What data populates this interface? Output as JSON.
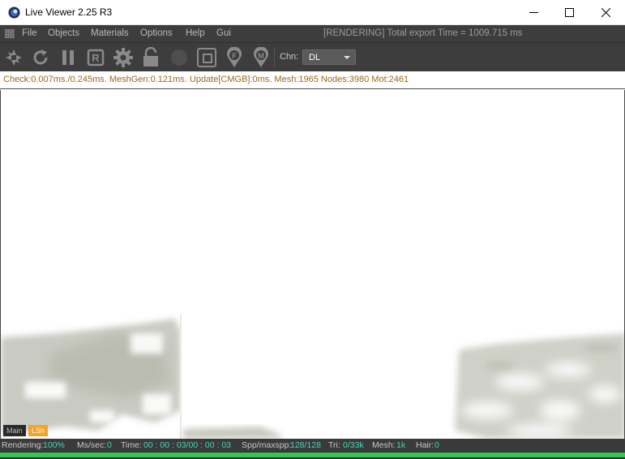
{
  "window": {
    "title": "Live Viewer 2.25 R3"
  },
  "menu": {
    "items": [
      "File",
      "Objects",
      "Materials",
      "Options",
      "Help",
      "Gui"
    ],
    "status": "[RENDERING] Total export Time = 1009.715 ms"
  },
  "toolbar": {
    "icons": [
      "aperture-icon",
      "refresh-icon",
      "pause-icon",
      "region-render-icon",
      "settings-gear-icon",
      "lock-open-icon",
      "record-dot-icon",
      "region-crop-icon",
      "focus-pin-icon",
      "material-pin-icon"
    ],
    "channel_label": "Chn:",
    "channel_value": "DL"
  },
  "stats": {
    "text": "Check:0.007ms./0.245ms. MeshGen:0.121ms. Update[CMGB]:0ms. Mesh:1965 Nodes:3980 Mot:2461"
  },
  "tags": {
    "main": "Main",
    "lsh": "LSh"
  },
  "status": {
    "rendering_label": "Rendering:",
    "rendering_value": "100%",
    "ms_label": "Ms/sec:",
    "ms_value": "0",
    "time_label": "Time:",
    "time_value": "00 : 00 : 03/00 : 00 : 03",
    "spp_label": "Spp/maxspp:",
    "spp_value": "128/128",
    "tri_label": "Tri:",
    "tri_value": "0/33k",
    "mesh_label": "Mesh:",
    "mesh_value": "1k",
    "hair_label": "Hair:",
    "hair_value": "0"
  },
  "progress": {
    "fraction": 1.0
  },
  "colors": {
    "accent": "#37c25a",
    "status_value": "#3fd9b9",
    "stats_text": "#9a6a1a",
    "tag_lsh": "#f2a32a"
  }
}
